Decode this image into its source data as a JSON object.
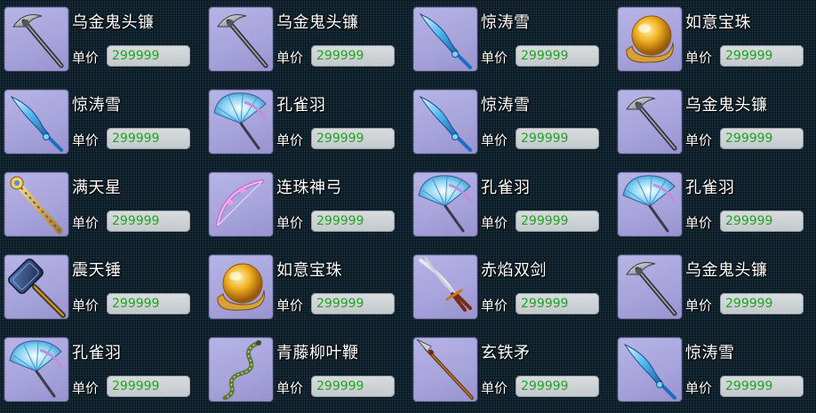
{
  "shop": {
    "price_label": "单价",
    "items": [
      {
        "name": "乌金鬼头镰",
        "price": "299999",
        "icon": "scythe-icon"
      },
      {
        "name": "乌金鬼头镰",
        "price": "299999",
        "icon": "scythe-icon"
      },
      {
        "name": "惊涛雪",
        "price": "299999",
        "icon": "blue-sword-icon"
      },
      {
        "name": "如意宝珠",
        "price": "299999",
        "icon": "golden-orb-icon"
      },
      {
        "name": "惊涛雪",
        "price": "299999",
        "icon": "blue-sword-icon"
      },
      {
        "name": "孔雀羽",
        "price": "299999",
        "icon": "peacock-fan-icon"
      },
      {
        "name": "惊涛雪",
        "price": "299999",
        "icon": "blue-sword-icon"
      },
      {
        "name": "乌金鬼头镰",
        "price": "299999",
        "icon": "scythe-icon"
      },
      {
        "name": "满天星",
        "price": "299999",
        "icon": "star-staff-icon"
      },
      {
        "name": "连珠神弓",
        "price": "299999",
        "icon": "bow-icon"
      },
      {
        "name": "孔雀羽",
        "price": "299999",
        "icon": "peacock-fan-icon"
      },
      {
        "name": "孔雀羽",
        "price": "299999",
        "icon": "peacock-fan-icon"
      },
      {
        "name": "震天锤",
        "price": "299999",
        "icon": "hammer-icon"
      },
      {
        "name": "如意宝珠",
        "price": "299999",
        "icon": "golden-orb-icon"
      },
      {
        "name": "赤焰双剑",
        "price": "299999",
        "icon": "twin-swords-icon"
      },
      {
        "name": "乌金鬼头镰",
        "price": "299999",
        "icon": "scythe-icon"
      },
      {
        "name": "孔雀羽",
        "price": "299999",
        "icon": "peacock-fan-icon"
      },
      {
        "name": "青藤柳叶鞭",
        "price": "299999",
        "icon": "vine-whip-icon"
      },
      {
        "name": "玄铁矛",
        "price": "299999",
        "icon": "spear-icon"
      },
      {
        "name": "惊涛雪",
        "price": "299999",
        "icon": "blue-sword-icon"
      }
    ]
  }
}
